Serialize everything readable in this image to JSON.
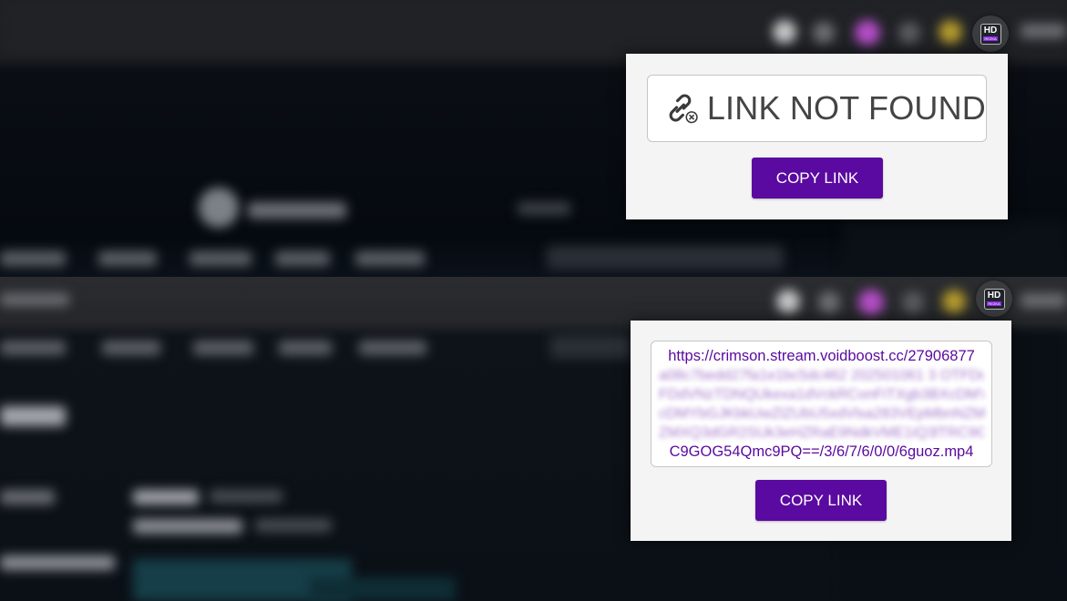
{
  "badge": {
    "main": "HD",
    "sub": "REZKA"
  },
  "popup_top": {
    "status_text": "LINK NOT FOUND",
    "copy_label": "COPY LINK"
  },
  "popup_bottom": {
    "link_first_line": "https://crimson.stream.voidboost.cc/27906877",
    "link_last_line": "C9GOG54Qmc9PQ==/3/6/7/6/0/0/6guoz.mp4",
    "copy_label": "COPY LINK"
  },
  "colors": {
    "accent": "#5a0aa0",
    "popup_bg": "#f4f4f4",
    "status_text": "#444444"
  }
}
